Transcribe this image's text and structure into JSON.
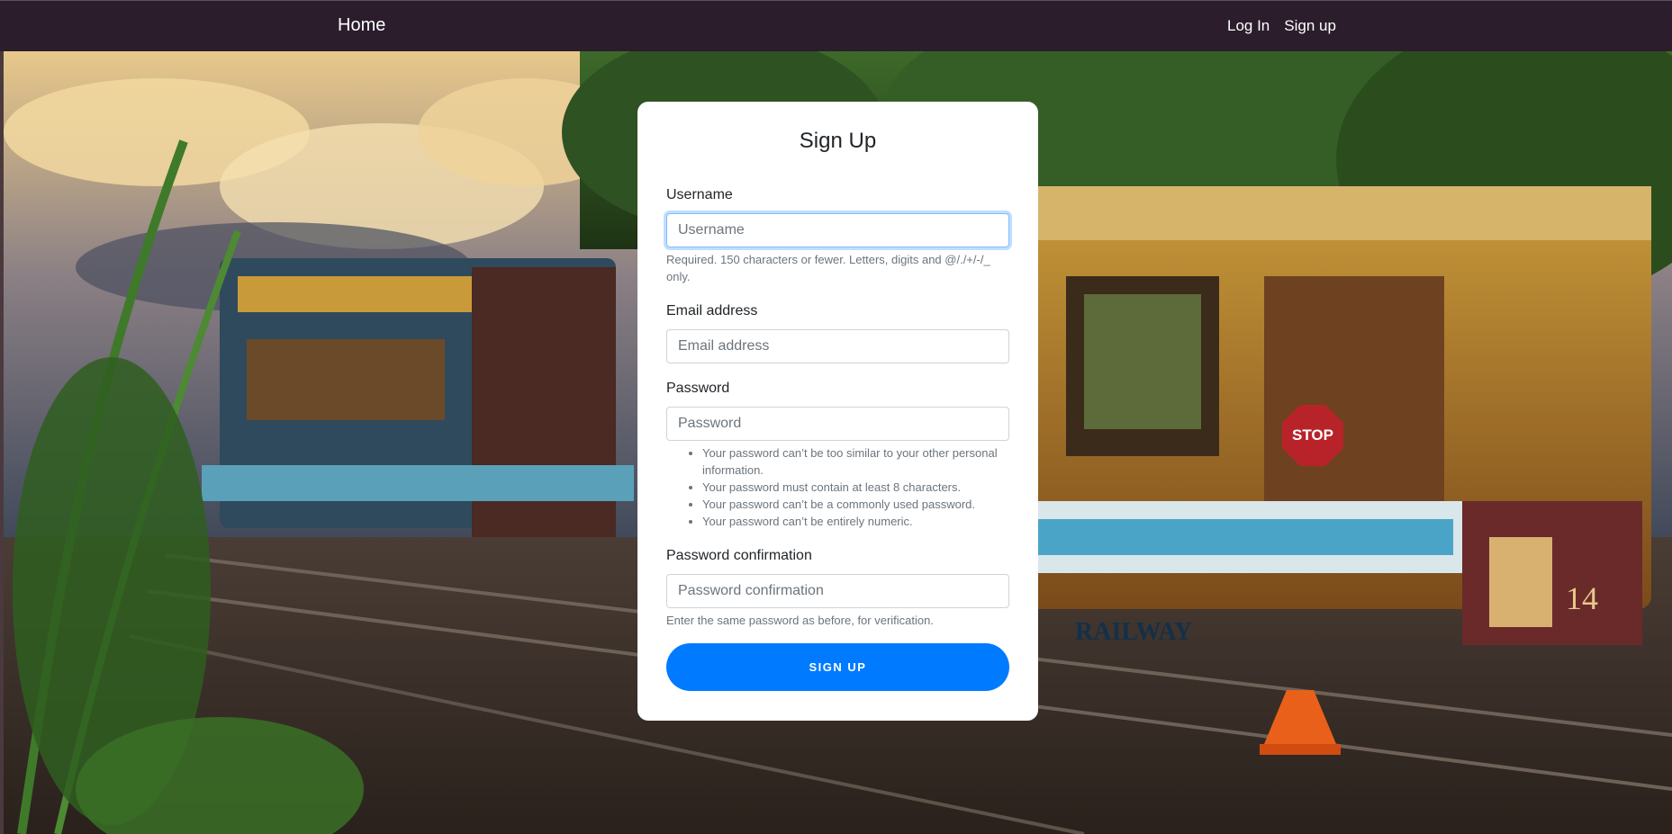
{
  "nav": {
    "home": "Home",
    "login": "Log In",
    "signup": "Sign up"
  },
  "form": {
    "title": "Sign Up",
    "username": {
      "label": "Username",
      "placeholder": "Username",
      "help": "Required. 150 characters or fewer. Letters, digits and @/./+/-/_ only."
    },
    "email": {
      "label": "Email address",
      "placeholder": "Email address"
    },
    "password": {
      "label": "Password",
      "placeholder": "Password",
      "rules": [
        "Your password can’t be too similar to your other personal information.",
        "Your password must contain at least 8 characters.",
        "Your password can’t be a commonly used password.",
        "Your password can’t be entirely numeric."
      ]
    },
    "password_confirm": {
      "label": "Password confirmation",
      "placeholder": "Password confirmation",
      "help": "Enter the same password as before, for verification."
    },
    "submit": "SIGN UP"
  },
  "background": {
    "tram_text": "RAILWAY",
    "tram_number": "14",
    "sign_text": "STOP"
  },
  "colors": {
    "navbar": "#2b1d2c",
    "accent": "#007bff",
    "card": "#ffffff"
  }
}
